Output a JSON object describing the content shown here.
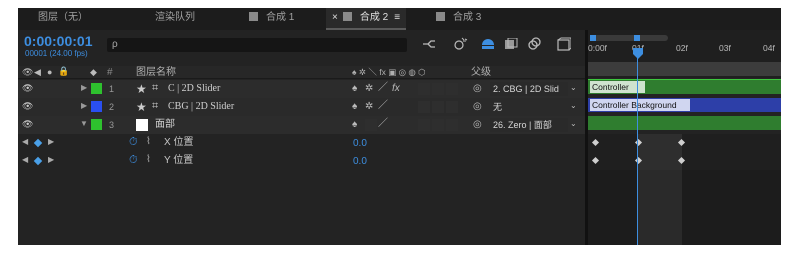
{
  "tabs": [
    {
      "label": "图层（无）"
    },
    {
      "label": "渲染队列"
    },
    {
      "label": "合成 1"
    },
    {
      "label": "合成 2"
    },
    {
      "label": "合成 3"
    }
  ],
  "tab_close": "×",
  "tab_menu": "≡",
  "timecode": "0:00:00:01",
  "frame_info": "00001 (24.00 fps)",
  "search_icon": "ρ",
  "header": {
    "layer_name": "图层名称",
    "hash": "#",
    "parent": "父级",
    "switch_icons": "♠ ✲ ＼ fx ▣ ◎ ◍ ⬡"
  },
  "layers": [
    {
      "num": "1",
      "color": "#2ec12e",
      "name": "C | 2D Slider",
      "parent": "2. CBG | 2D Slid",
      "track": "#2f7d2f",
      "bar_label": "Controller"
    },
    {
      "num": "2",
      "color": "#2a4ff0",
      "name": "CBG | 2D Slider",
      "parent": "无",
      "track": "#2d3fa8",
      "bar_label": "Controller Background"
    },
    {
      "num": "3",
      "color": "#2ec12e",
      "name": "面部",
      "parent": "26. Zero | 面部",
      "track": "#2f7d2f",
      "bar_label": ""
    }
  ],
  "props": [
    {
      "name": "X 位置",
      "value": "0.0"
    },
    {
      "name": "Y 位置",
      "value": "0.0"
    }
  ],
  "ruler_labels": [
    "0:00f",
    "01f",
    "02f",
    "03f",
    "04f"
  ],
  "colors": {
    "accent": "#3d8ee0",
    "playhead": "#3d8ee0"
  }
}
